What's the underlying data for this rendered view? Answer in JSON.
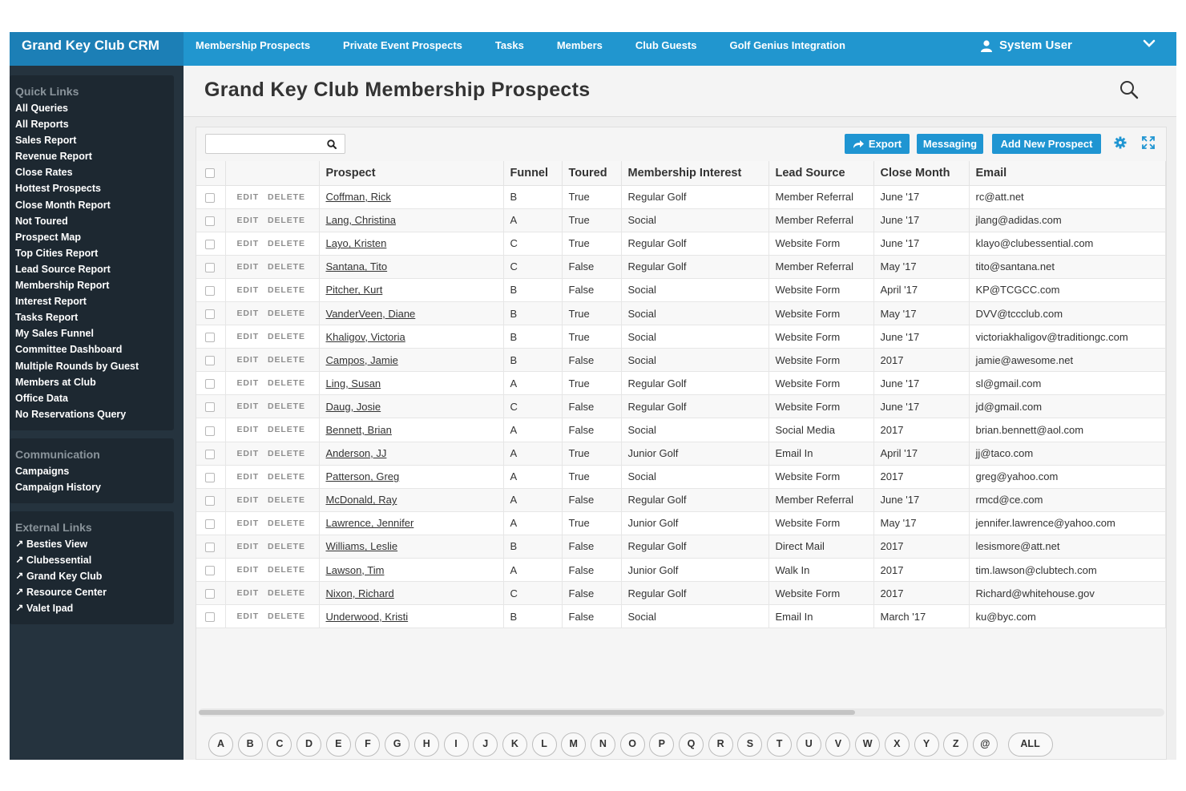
{
  "app": {
    "brand": "Grand Key Club CRM",
    "user_name": "System User",
    "accent": "#2196cf"
  },
  "nav": {
    "items": [
      "Membership Prospects",
      "Private Event Prospects",
      "Tasks",
      "Members",
      "Club Guests",
      "Golf Genius Integration"
    ]
  },
  "sidebar": {
    "quick_links": {
      "title": "Quick Links",
      "items": [
        "All Queries",
        "All Reports",
        "Sales Report",
        "Revenue Report",
        "Close Rates",
        "Hottest Prospects",
        "Close Month Report",
        "Not Toured",
        "Prospect Map",
        "Top Cities Report",
        "Lead Source Report",
        "Membership Report",
        "Interest Report",
        "Tasks Report",
        "My Sales Funnel",
        "Committee Dashboard",
        "Multiple Rounds by Guest",
        "Members at Club",
        "Office Data",
        "No Reservations Query"
      ]
    },
    "communication": {
      "title": "Communication",
      "items": [
        "Campaigns",
        "Campaign History"
      ]
    },
    "external_links": {
      "title": "External Links",
      "items": [
        "↗ Besties View",
        "↗ Clubessential",
        "↗ Grand Key Club",
        "↗ Resource Center",
        "↗ Valet Ipad"
      ]
    }
  },
  "page": {
    "title": "Grand Key Club Membership Prospects"
  },
  "toolbar": {
    "search_value": "",
    "export_label": "Export",
    "messaging_label": "Messaging",
    "add_label": "Add New Prospect"
  },
  "table": {
    "columns": [
      "Prospect",
      "Funnel",
      "Toured",
      "Membership Interest",
      "Lead Source",
      "Close Month",
      "Email"
    ],
    "edit_label": "EDIT",
    "delete_label": "DELETE",
    "rows": [
      [
        "Coffman, Rick",
        "B",
        "True",
        "Regular Golf",
        "Member Referral",
        "June '17",
        "rc@att.net"
      ],
      [
        "Lang, Christina",
        "A",
        "True",
        "Social",
        "Member Referral",
        "June '17",
        "jlang@adidas.com"
      ],
      [
        "Layo, Kristen",
        "C",
        "True",
        "Regular Golf",
        "Website Form",
        "June '17",
        "klayo@clubessential.com"
      ],
      [
        "Santana, Tito",
        "C",
        "False",
        "Regular Golf",
        "Member Referral",
        "May '17",
        "tito@santana.net"
      ],
      [
        "Pitcher, Kurt",
        "B",
        "False",
        "Social",
        "Website Form",
        "April '17",
        "KP@TCGCC.com"
      ],
      [
        "VanderVeen, Diane",
        "B",
        "True",
        "Social",
        "Website Form",
        "May '17",
        "DVV@tccclub.com"
      ],
      [
        "Khaligov, Victoria",
        "B",
        "True",
        "Social",
        "Website Form",
        "June '17",
        "victoriakhaligov@traditiongc.com"
      ],
      [
        "Campos, Jamie",
        "B",
        "False",
        "Social",
        "Website Form",
        "2017",
        "jamie@awesome.net"
      ],
      [
        "Ling, Susan",
        "A",
        "True",
        "Regular Golf",
        "Website Form",
        "June '17",
        "sl@gmail.com"
      ],
      [
        "Daug, Josie",
        "C",
        "False",
        "Regular Golf",
        "Website Form",
        "June '17",
        "jd@gmail.com"
      ],
      [
        "Bennett, Brian",
        "A",
        "False",
        "Social",
        "Social Media",
        "2017",
        "brian.bennett@aol.com"
      ],
      [
        "Anderson, JJ",
        "A",
        "True",
        "Junior Golf",
        "Email In",
        "April '17",
        "jj@taco.com"
      ],
      [
        "Patterson, Greg",
        "A",
        "True",
        "Social",
        "Website Form",
        "2017",
        "greg@yahoo.com"
      ],
      [
        "McDonald, Ray",
        "A",
        "False",
        "Regular Golf",
        "Member Referral",
        "June '17",
        "rmcd@ce.com"
      ],
      [
        "Lawrence, Jennifer",
        "A",
        "True",
        "Junior Golf",
        "Website Form",
        "May '17",
        "jennifer.lawrence@yahoo.com"
      ],
      [
        "Williams, Leslie",
        "B",
        "False",
        "Regular Golf",
        "Direct Mail",
        "2017",
        "lesismore@att.net"
      ],
      [
        "Lawson, Tim",
        "A",
        "False",
        "Junior Golf",
        "Walk In",
        "2017",
        "tim.lawson@clubtech.com"
      ],
      [
        "Nixon, Richard",
        "C",
        "False",
        "Regular Golf",
        "Website Form",
        "2017",
        "Richard@whitehouse.gov"
      ],
      [
        "Underwood, Kristi",
        "B",
        "False",
        "Social",
        "Email In",
        "March '17",
        "ku@byc.com"
      ]
    ]
  },
  "scrollbar": {
    "visible_fraction": 0.68
  },
  "alphabet": [
    "A",
    "B",
    "C",
    "D",
    "E",
    "F",
    "G",
    "H",
    "I",
    "J",
    "K",
    "L",
    "M",
    "N",
    "O",
    "P",
    "Q",
    "R",
    "S",
    "T",
    "U",
    "V",
    "W",
    "X",
    "Y",
    "Z",
    "@",
    "ALL"
  ],
  "icons": {
    "search": "search-icon",
    "user": "user-icon",
    "chevron": "chevron-down-icon",
    "export": "share-arrow-icon",
    "settings": "gear-icon",
    "expand": "expand-icon"
  }
}
